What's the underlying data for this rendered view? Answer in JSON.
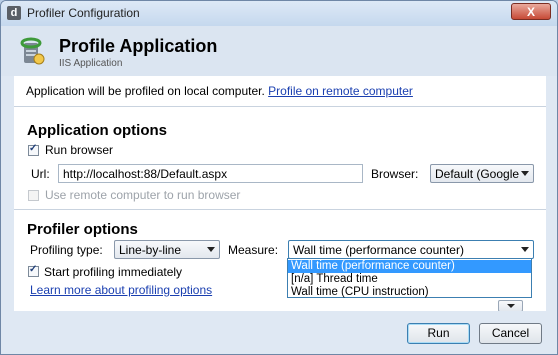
{
  "window": {
    "title": "Profiler Configuration",
    "app_icon_glyph": "d",
    "close_glyph": "X"
  },
  "header": {
    "title": "Profile Application",
    "subtitle": "IIS Application",
    "icon": "iis-application-icon"
  },
  "info": {
    "text": "Application will be profiled on local computer.",
    "remote_link": "Profile on remote computer"
  },
  "application_options": {
    "title": "Application options",
    "run_browser": {
      "label": "Run browser",
      "checked": true
    },
    "url": {
      "label": "Url:",
      "value": "http://localhost:88/Default.aspx"
    },
    "browser": {
      "label": "Browser:",
      "value": "Default (Google"
    },
    "remote_computer": {
      "label": "Use remote computer to run browser",
      "checked": false,
      "enabled": false
    }
  },
  "profiler_options": {
    "title": "Profiler options",
    "profiling_type": {
      "label": "Profiling type:",
      "value": "Line-by-line"
    },
    "measure": {
      "label": "Measure:",
      "value": "Wall time (performance counter)",
      "options": [
        {
          "label": "Wall time (performance counter)",
          "selected": true
        },
        {
          "label": "[n/a] Thread time",
          "selected": false
        },
        {
          "label": "Wall time (CPU instruction)",
          "selected": false
        }
      ]
    },
    "start_immediately": {
      "label": "Start profiling immediately",
      "checked": true
    },
    "learn_more_link": "Learn more about profiling options"
  },
  "footer": {
    "run_label": "Run",
    "cancel_label": "Cancel"
  },
  "colors": {
    "link": "#1a3fb0",
    "selection": "#3399ff",
    "close_button": "#c74a36"
  }
}
